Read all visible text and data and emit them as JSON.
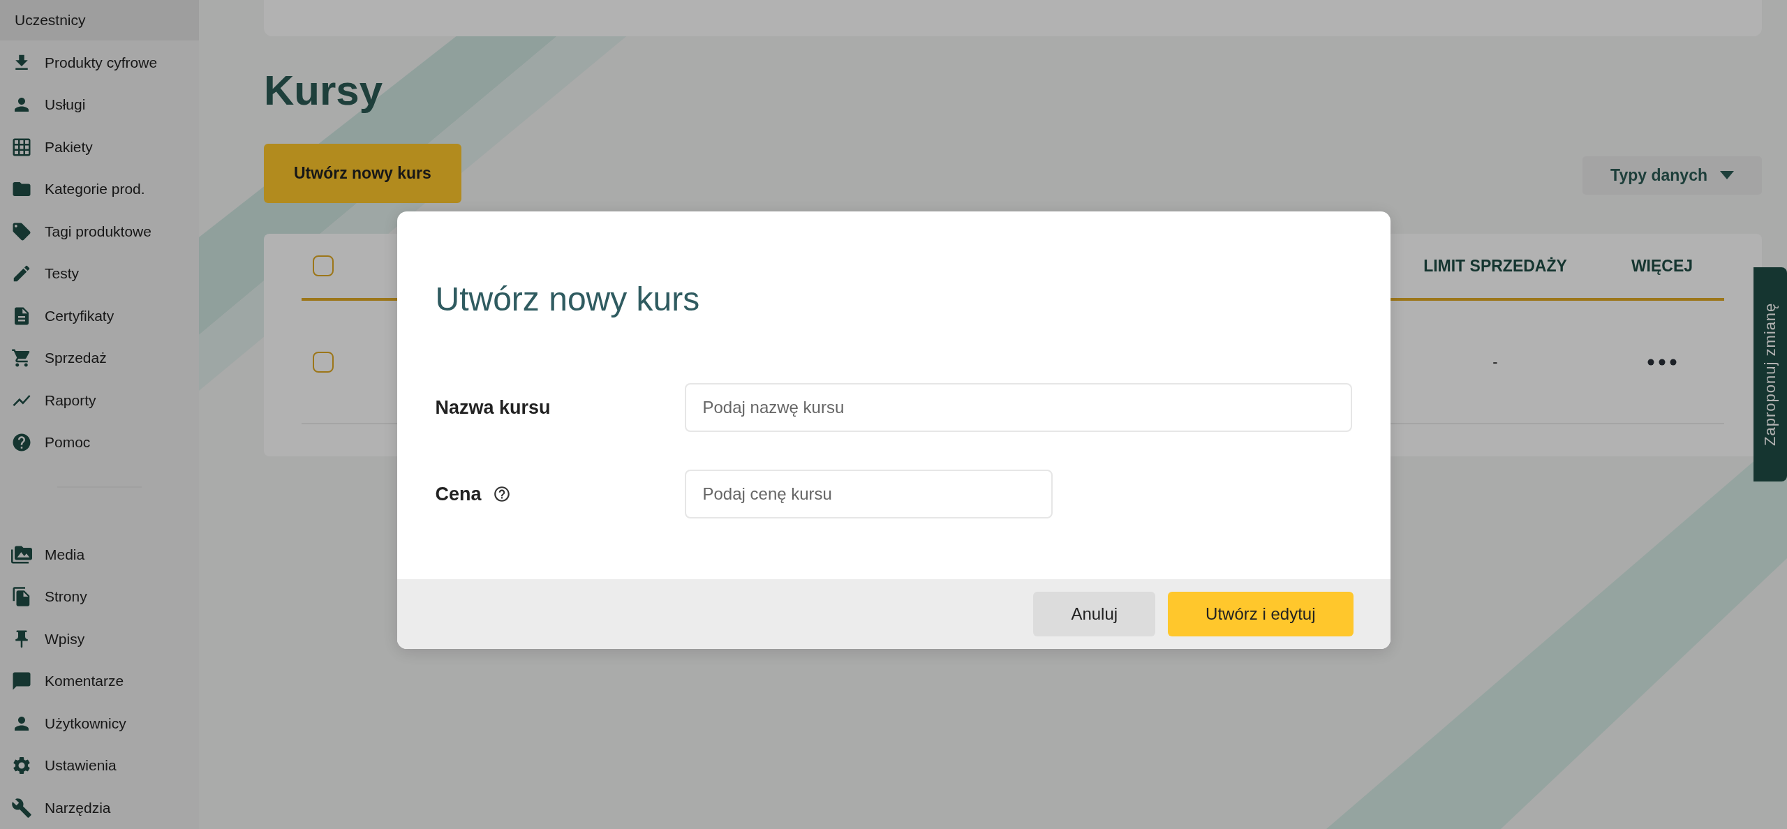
{
  "sidebar": {
    "top_item": {
      "label": "Uczestnicy"
    },
    "groups": [
      {
        "items": [
          {
            "label": "Produkty cyfrowe"
          },
          {
            "label": "Usługi"
          },
          {
            "label": "Pakiety"
          },
          {
            "label": "Kategorie prod."
          },
          {
            "label": "Tagi produktowe"
          },
          {
            "label": "Testy"
          },
          {
            "label": "Certyfikaty"
          },
          {
            "label": "Sprzedaż"
          },
          {
            "label": "Raporty"
          },
          {
            "label": "Pomoc"
          }
        ]
      },
      {
        "items": [
          {
            "label": "Media"
          },
          {
            "label": "Strony"
          },
          {
            "label": "Wpisy"
          },
          {
            "label": "Komentarze"
          },
          {
            "label": "Użytkownicy"
          },
          {
            "label": "Ustawienia"
          },
          {
            "label": "Narzędzia"
          }
        ]
      }
    ]
  },
  "page": {
    "title": "Kursy",
    "create_button": "Utwórz nowy kurs",
    "data_types_button": "Typy danych"
  },
  "table": {
    "header_checkbox": {
      "checked": false
    },
    "columns": [
      "LIMIT SPRZEDAŻY",
      "WIĘCEJ"
    ],
    "rows": [
      {
        "checked": false,
        "sales_limit": "-"
      }
    ]
  },
  "feedback_tab": "Zaproponuj zmianę",
  "modal": {
    "title": "Utwórz nowy kurs",
    "fields": [
      {
        "label": "Nazwa kursu",
        "placeholder": "Podaj nazwę kursu",
        "kind": "wide",
        "help": false
      },
      {
        "label": "Cena",
        "placeholder": "Podaj cenę kursu",
        "kind": "short",
        "help": true
      }
    ],
    "buttons": [
      {
        "label": "Anuluj",
        "kind": "secondary"
      },
      {
        "label": "Utwórz i edytuj",
        "kind": "primary"
      }
    ]
  }
}
